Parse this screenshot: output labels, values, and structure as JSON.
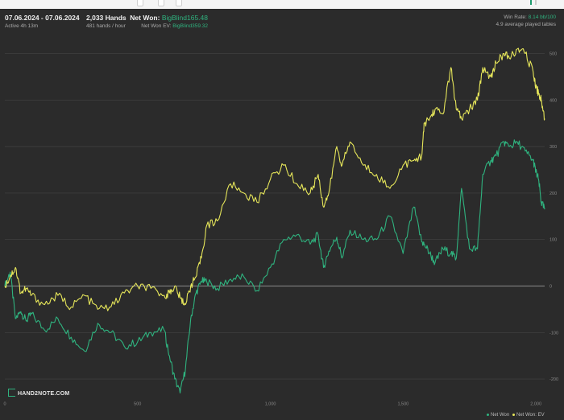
{
  "stats": {
    "date_range": "07.06.2024 - 07.06.2024",
    "active": "Active 4h 13m",
    "hands": "2,033 Hands",
    "hands_per_hour": "481 hands / hour",
    "net_won_label": "Net Won:",
    "net_won_value": "BigBlind165.48",
    "net_won_ev_label": "Net Won EV:",
    "net_won_ev_value": "BigBlind359.32",
    "win_rate_label": "Win Rate:",
    "win_rate_value": "8.14 bb/100",
    "tables": "4.9 average played tables"
  },
  "logo": "HAND2NOTE.COM",
  "colors": {
    "net_won": "#2fb37f",
    "net_won_ev": "#e6e65a",
    "background": "#2b2b2b",
    "grid": "#444444",
    "zero_line": "#8a8a8a"
  },
  "chart_data": {
    "type": "line",
    "x_ticks": [
      "0",
      "500",
      "1,000",
      "1,500",
      "2,000"
    ],
    "y_ticks": [
      "500",
      "400",
      "300",
      "200",
      "100",
      "0",
      "-100",
      "-200"
    ],
    "xlim": [
      0,
      2033
    ],
    "ylim": [
      -250,
      520
    ],
    "legend_position": "bottom-right",
    "series": [
      {
        "name": "Net Won",
        "color": "#2fb37f",
        "x": [
          0,
          20,
          40,
          60,
          80,
          100,
          150,
          200,
          250,
          300,
          350,
          400,
          450,
          500,
          550,
          600,
          620,
          640,
          660,
          680,
          700,
          720,
          740,
          760,
          800,
          850,
          900,
          950,
          1000,
          1050,
          1100,
          1150,
          1180,
          1200,
          1220,
          1250,
          1270,
          1300,
          1350,
          1400,
          1450,
          1500,
          1540,
          1570,
          1580,
          1600,
          1620,
          1650,
          1680,
          1700,
          1720,
          1750,
          1780,
          1800,
          1830,
          1850,
          1880,
          1900,
          1930,
          1960,
          1990,
          2000,
          2010,
          2020,
          2033
        ],
        "y": [
          0,
          30,
          -70,
          -55,
          -75,
          -60,
          -95,
          -70,
          -110,
          -140,
          -80,
          -100,
          -130,
          -120,
          -100,
          -95,
          -150,
          -200,
          -230,
          -180,
          -70,
          -15,
          10,
          10,
          -5,
          15,
          20,
          -10,
          40,
          100,
          110,
          90,
          110,
          40,
          75,
          105,
          60,
          120,
          100,
          100,
          150,
          70,
          170,
          95,
          90,
          70,
          50,
          80,
          70,
          60,
          210,
          80,
          80,
          240,
          270,
          280,
          310,
          300,
          310,
          290,
          270,
          245,
          230,
          180,
          165
        ]
      },
      {
        "name": "Net Won: EV",
        "color": "#e6e65a",
        "x": [
          0,
          20,
          40,
          60,
          80,
          100,
          150,
          200,
          250,
          300,
          350,
          400,
          450,
          500,
          550,
          600,
          620,
          640,
          660,
          680,
          700,
          720,
          740,
          760,
          800,
          850,
          900,
          950,
          1000,
          1050,
          1100,
          1150,
          1180,
          1200,
          1220,
          1250,
          1270,
          1300,
          1350,
          1400,
          1450,
          1500,
          1540,
          1570,
          1580,
          1600,
          1620,
          1650,
          1680,
          1700,
          1720,
          1750,
          1780,
          1800,
          1830,
          1850,
          1880,
          1900,
          1930,
          1960,
          1990,
          2000,
          2010,
          2020,
          2033
        ],
        "y": [
          0,
          20,
          40,
          -15,
          -5,
          -20,
          -40,
          -20,
          -45,
          -20,
          -50,
          -45,
          -15,
          0,
          -5,
          -20,
          -15,
          0,
          -25,
          -40,
          0,
          20,
          60,
          130,
          140,
          220,
          200,
          180,
          230,
          260,
          220,
          200,
          240,
          170,
          200,
          300,
          260,
          310,
          260,
          240,
          210,
          260,
          270,
          280,
          350,
          360,
          380,
          370,
          470,
          380,
          360,
          380,
          400,
          470,
          450,
          480,
          500,
          490,
          510,
          500,
          460,
          430,
          415,
          400,
          360
        ]
      }
    ]
  }
}
